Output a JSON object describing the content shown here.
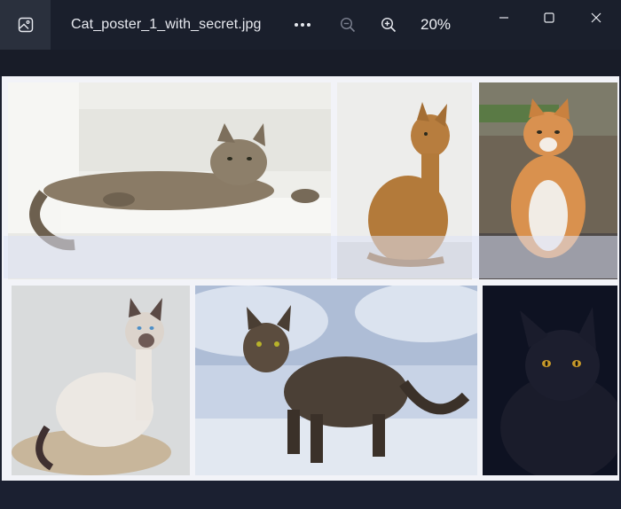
{
  "window": {
    "file_name": "Cat_poster_1_with_secret.jpg",
    "zoom_level": "20%"
  },
  "toolbar": {
    "more_icon": "more-horizontal-icon",
    "zoom_out_icon": "zoom-out-icon",
    "zoom_in_icon": "zoom-in-icon"
  },
  "window_controls": [
    "minimize-icon",
    "maximize-icon",
    "close-icon"
  ],
  "image": {
    "photos": [
      "tabby-cat-lying",
      "abyssinian-cat-sitting",
      "orange-white-cat-sitting",
      "siamese-cat-sitting",
      "tabby-cat-in-snow",
      "black-cat-dark"
    ]
  }
}
